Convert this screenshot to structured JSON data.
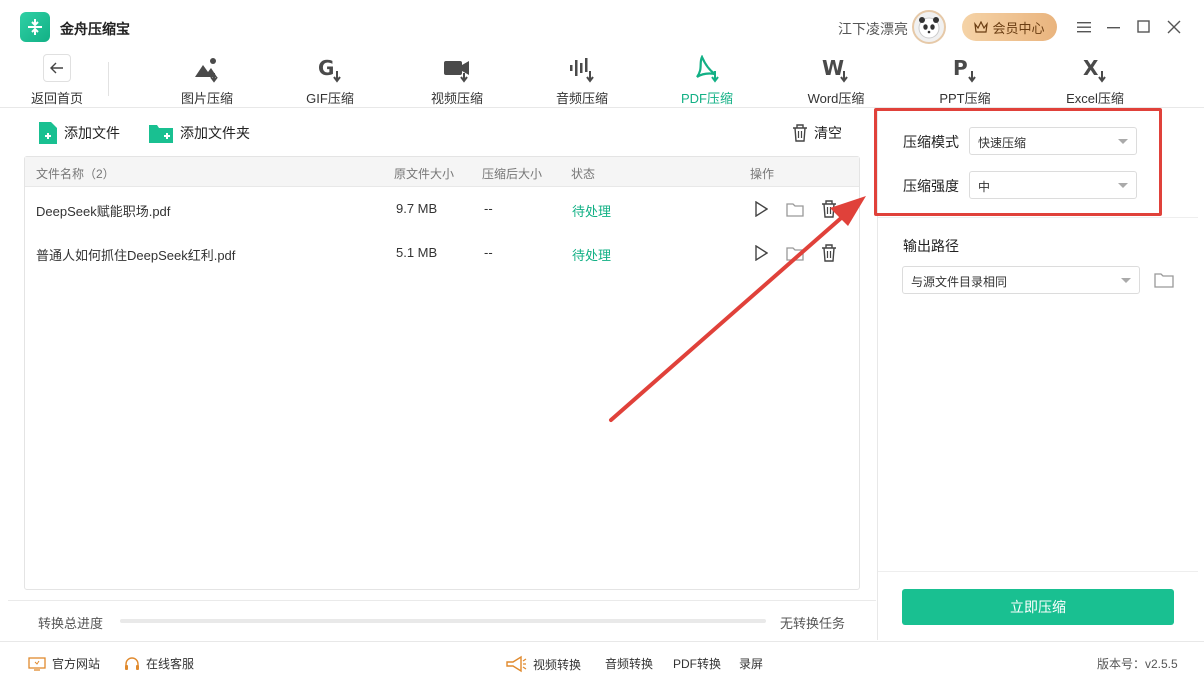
{
  "app": {
    "title": "金舟压缩宝"
  },
  "header": {
    "user_name": "江下凌漂亮",
    "vip_label": "会员中心"
  },
  "toolbar": {
    "back_label": "返回首页",
    "tools": [
      {
        "label": "图片压缩",
        "icon": "image-compress-icon"
      },
      {
        "label": "GIF压缩",
        "icon": "gif-compress-icon"
      },
      {
        "label": "视频压缩",
        "icon": "video-compress-icon"
      },
      {
        "label": "音频压缩",
        "icon": "audio-compress-icon"
      },
      {
        "label": "PDF压缩",
        "icon": "pdf-compress-icon",
        "active": true
      },
      {
        "label": "Word压缩",
        "icon": "word-compress-icon"
      },
      {
        "label": "PPT压缩",
        "icon": "ppt-compress-icon"
      },
      {
        "label": "Excel压缩",
        "icon": "excel-compress-icon"
      }
    ]
  },
  "actions": {
    "add_file": "添加文件",
    "add_folder": "添加文件夹",
    "clear": "清空"
  },
  "table": {
    "headers": {
      "name": "文件名称（2）",
      "orig_size": "原文件大小",
      "compressed_size": "压缩后大小",
      "status": "状态",
      "ops": "操作"
    },
    "rows": [
      {
        "name": "DeepSeek赋能职场.pdf",
        "orig_size": "9.7 MB",
        "compressed_size": "--",
        "status": "待处理"
      },
      {
        "name": "普通人如何抓住DeepSeek红利.pdf",
        "orig_size": "5.1 MB",
        "compressed_size": "--",
        "status": "待处理"
      }
    ]
  },
  "progress": {
    "label": "转换总进度",
    "value_percent": 0,
    "status": "无转换任务"
  },
  "settings": {
    "mode_label": "压缩模式",
    "mode_value": "快速压缩",
    "strength_label": "压缩强度",
    "strength_value": "中",
    "output_label": "输出路径",
    "output_value": "与源文件目录相同",
    "compress_button": "立即压缩"
  },
  "footer": {
    "website": "官方网站",
    "support": "在线客服",
    "video_convert": "视频转换",
    "audio_convert": "音频转换",
    "pdf_convert": "PDF转换",
    "record": "录屏",
    "version": "版本号：v2.5.5"
  },
  "colors": {
    "accent": "#12b085",
    "highlight": "#e0413a"
  }
}
